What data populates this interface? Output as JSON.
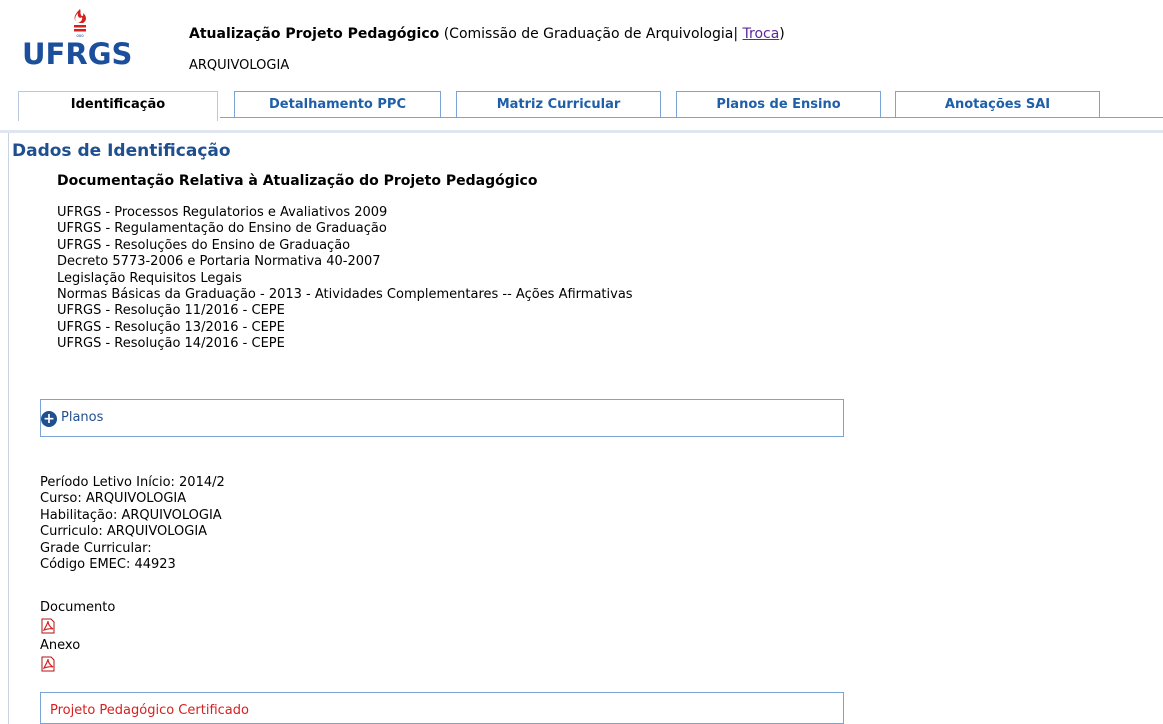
{
  "header": {
    "logo_text": "UFRGS",
    "title_bold": "Atualização Projeto Pedagógico",
    "title_rest": " (Comissão de Graduação de Arquivologia| ",
    "change_link": "Troca",
    "title_close": ")",
    "subtitle": "ARQUIVOLOGIA"
  },
  "tabs": [
    {
      "label": "Identificação",
      "active": true
    },
    {
      "label": "Detalhamento PPC",
      "active": false
    },
    {
      "label": "Matriz Curricular",
      "active": false
    },
    {
      "label": "Planos de Ensino",
      "active": false
    },
    {
      "label": "Anotações SAI",
      "active": false
    }
  ],
  "main": {
    "section_title": "Dados de Identificação",
    "doc_heading": "Documentação Relativa à Atualização do Projeto Pedagógico",
    "documents": [
      "UFRGS - Processos Regulatorios e Avaliativos 2009",
      "UFRGS - Regulamentação do Ensino de Graduação",
      "UFRGS - Resoluções do Ensino de Graduação",
      "Decreto 5773-2006 e Portaria Normativa 40-2007",
      "Legislação Requisitos Legais",
      "Normas Básicas da Graduação - 2013 - Atividades Complementares -- Ações Afirmativas",
      "UFRGS - Resolução 11/2016 - CEPE",
      "UFRGS - Resolução 13/2016 - CEPE",
      "UFRGS - Resolução 14/2016 - CEPE"
    ],
    "planos_label": "Planos",
    "info": [
      "Período Letivo Início: 2014/2",
      "Curso: ARQUIVOLOGIA",
      "Habilitação: ARQUIVOLOGIA",
      "Curriculo: ARQUIVOLOGIA",
      "Grade Curricular:",
      "Código EMEC: 44923"
    ],
    "documento_label": "Documento",
    "anexo_label": "Anexo",
    "certificado_label": "Projeto Pedagógico Certificado"
  },
  "colors": {
    "brand_blue": "#1b4f9c",
    "logo_red": "#d62020",
    "certified_red": "#d62020"
  },
  "icons": {
    "logo": "ufrgs-flame-icon",
    "planos": "plus-circle-icon",
    "documento": "pdf-icon",
    "anexo": "pdf-icon"
  }
}
